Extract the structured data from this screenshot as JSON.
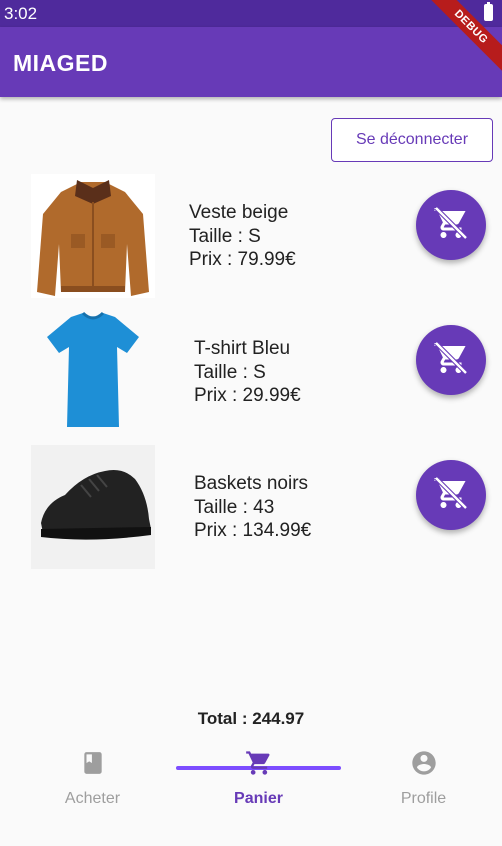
{
  "status_bar": {
    "time": "3:02"
  },
  "debug_banner": "DEBUG",
  "app_bar": {
    "title": "MIAGED"
  },
  "logout_label": "Se déconnecter",
  "cart_items": [
    {
      "name": "Veste beige",
      "size": "Taille : S",
      "price": "Prix : 79.99€",
      "image": "brown-jacket",
      "action_icon": "remove-shopping-cart-icon"
    },
    {
      "name": "T-shirt Bleu",
      "size": "Taille : S",
      "price": "Prix : 29.99€",
      "image": "blue-tshirt",
      "action_icon": "remove-shopping-cart-icon"
    },
    {
      "name": "Baskets noirs",
      "size": "Taille : 43",
      "price": "Prix : 134.99€",
      "image": "black-sneaker",
      "action_icon": "remove-shopping-cart-icon"
    }
  ],
  "total": "Total : 244.97",
  "bottom_nav": [
    {
      "label": "Acheter",
      "icon": "book-icon",
      "active": false
    },
    {
      "label": "Panier",
      "icon": "shopping-cart-icon",
      "active": true
    },
    {
      "label": "Profile",
      "icon": "account-circle-icon",
      "active": false
    }
  ],
  "colors": {
    "primary": "#673ab7",
    "status_bar": "#4f2a9c",
    "indicator": "#7c4dff",
    "debug": "#b71c1c"
  }
}
